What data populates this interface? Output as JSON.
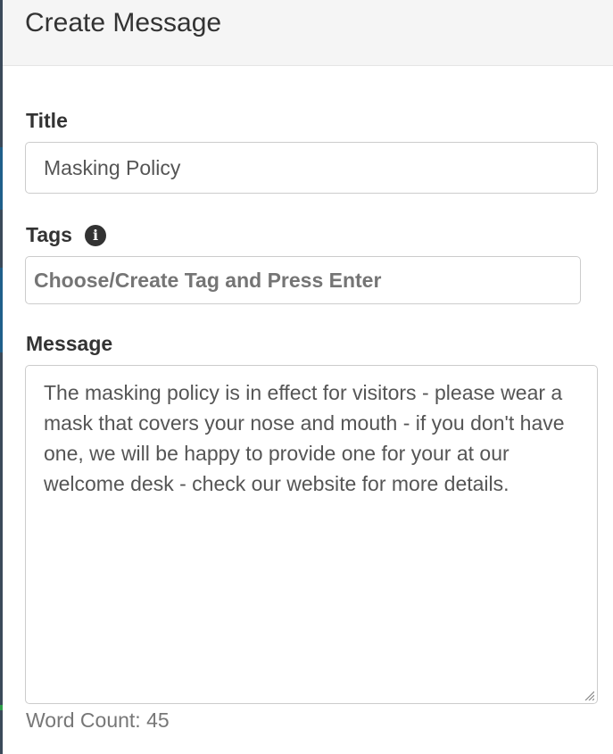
{
  "modal": {
    "title": "Create Message"
  },
  "form": {
    "title_label": "Title",
    "title_value": "Masking Policy",
    "tags_label": "Tags",
    "tags_info_icon": "info-circle-icon",
    "tags_placeholder": "Choose/Create Tag and Press Enter",
    "message_label": "Message",
    "message_value": "The masking policy is in effect for visitors - please wear a mask that covers your nose and mouth - if you don't have one, we will be happy to provide one for your at our welcome desk - check our website for more details.",
    "word_count_text": "Word Count: 45"
  },
  "colors": {
    "header_bg": "#f5f5f5",
    "label_text": "#333333",
    "input_border": "#cccccc",
    "placeholder": "#9a9a9a",
    "muted_text": "#777777"
  }
}
